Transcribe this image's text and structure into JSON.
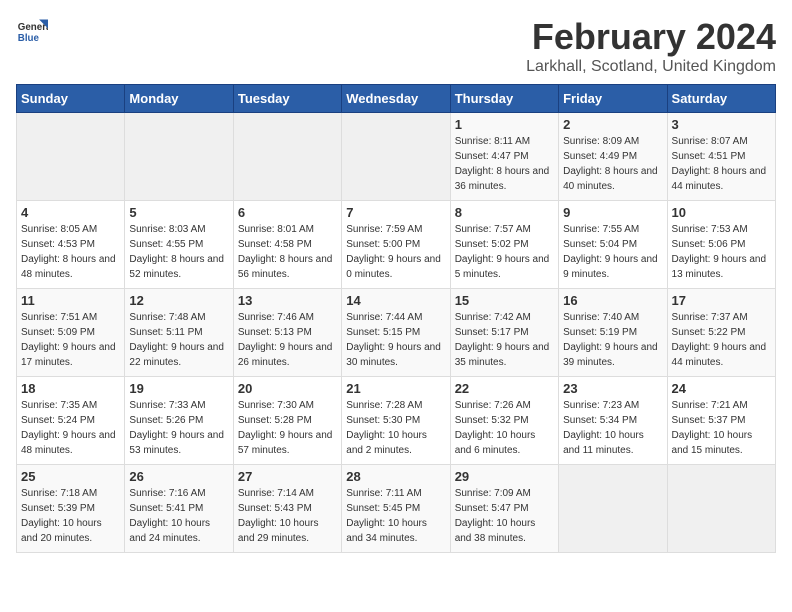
{
  "header": {
    "logo_line1": "General",
    "logo_line2": "Blue",
    "title": "February 2024",
    "subtitle": "Larkhall, Scotland, United Kingdom"
  },
  "weekdays": [
    "Sunday",
    "Monday",
    "Tuesday",
    "Wednesday",
    "Thursday",
    "Friday",
    "Saturday"
  ],
  "weeks": [
    [
      {
        "day": "",
        "sunrise": "",
        "sunset": "",
        "daylight": ""
      },
      {
        "day": "",
        "sunrise": "",
        "sunset": "",
        "daylight": ""
      },
      {
        "day": "",
        "sunrise": "",
        "sunset": "",
        "daylight": ""
      },
      {
        "day": "",
        "sunrise": "",
        "sunset": "",
        "daylight": ""
      },
      {
        "day": "1",
        "sunrise": "Sunrise: 8:11 AM",
        "sunset": "Sunset: 4:47 PM",
        "daylight": "Daylight: 8 hours and 36 minutes."
      },
      {
        "day": "2",
        "sunrise": "Sunrise: 8:09 AM",
        "sunset": "Sunset: 4:49 PM",
        "daylight": "Daylight: 8 hours and 40 minutes."
      },
      {
        "day": "3",
        "sunrise": "Sunrise: 8:07 AM",
        "sunset": "Sunset: 4:51 PM",
        "daylight": "Daylight: 8 hours and 44 minutes."
      }
    ],
    [
      {
        "day": "4",
        "sunrise": "Sunrise: 8:05 AM",
        "sunset": "Sunset: 4:53 PM",
        "daylight": "Daylight: 8 hours and 48 minutes."
      },
      {
        "day": "5",
        "sunrise": "Sunrise: 8:03 AM",
        "sunset": "Sunset: 4:55 PM",
        "daylight": "Daylight: 8 hours and 52 minutes."
      },
      {
        "day": "6",
        "sunrise": "Sunrise: 8:01 AM",
        "sunset": "Sunset: 4:58 PM",
        "daylight": "Daylight: 8 hours and 56 minutes."
      },
      {
        "day": "7",
        "sunrise": "Sunrise: 7:59 AM",
        "sunset": "Sunset: 5:00 PM",
        "daylight": "Daylight: 9 hours and 0 minutes."
      },
      {
        "day": "8",
        "sunrise": "Sunrise: 7:57 AM",
        "sunset": "Sunset: 5:02 PM",
        "daylight": "Daylight: 9 hours and 5 minutes."
      },
      {
        "day": "9",
        "sunrise": "Sunrise: 7:55 AM",
        "sunset": "Sunset: 5:04 PM",
        "daylight": "Daylight: 9 hours and 9 minutes."
      },
      {
        "day": "10",
        "sunrise": "Sunrise: 7:53 AM",
        "sunset": "Sunset: 5:06 PM",
        "daylight": "Daylight: 9 hours and 13 minutes."
      }
    ],
    [
      {
        "day": "11",
        "sunrise": "Sunrise: 7:51 AM",
        "sunset": "Sunset: 5:09 PM",
        "daylight": "Daylight: 9 hours and 17 minutes."
      },
      {
        "day": "12",
        "sunrise": "Sunrise: 7:48 AM",
        "sunset": "Sunset: 5:11 PM",
        "daylight": "Daylight: 9 hours and 22 minutes."
      },
      {
        "day": "13",
        "sunrise": "Sunrise: 7:46 AM",
        "sunset": "Sunset: 5:13 PM",
        "daylight": "Daylight: 9 hours and 26 minutes."
      },
      {
        "day": "14",
        "sunrise": "Sunrise: 7:44 AM",
        "sunset": "Sunset: 5:15 PM",
        "daylight": "Daylight: 9 hours and 30 minutes."
      },
      {
        "day": "15",
        "sunrise": "Sunrise: 7:42 AM",
        "sunset": "Sunset: 5:17 PM",
        "daylight": "Daylight: 9 hours and 35 minutes."
      },
      {
        "day": "16",
        "sunrise": "Sunrise: 7:40 AM",
        "sunset": "Sunset: 5:19 PM",
        "daylight": "Daylight: 9 hours and 39 minutes."
      },
      {
        "day": "17",
        "sunrise": "Sunrise: 7:37 AM",
        "sunset": "Sunset: 5:22 PM",
        "daylight": "Daylight: 9 hours and 44 minutes."
      }
    ],
    [
      {
        "day": "18",
        "sunrise": "Sunrise: 7:35 AM",
        "sunset": "Sunset: 5:24 PM",
        "daylight": "Daylight: 9 hours and 48 minutes."
      },
      {
        "day": "19",
        "sunrise": "Sunrise: 7:33 AM",
        "sunset": "Sunset: 5:26 PM",
        "daylight": "Daylight: 9 hours and 53 minutes."
      },
      {
        "day": "20",
        "sunrise": "Sunrise: 7:30 AM",
        "sunset": "Sunset: 5:28 PM",
        "daylight": "Daylight: 9 hours and 57 minutes."
      },
      {
        "day": "21",
        "sunrise": "Sunrise: 7:28 AM",
        "sunset": "Sunset: 5:30 PM",
        "daylight": "Daylight: 10 hours and 2 minutes."
      },
      {
        "day": "22",
        "sunrise": "Sunrise: 7:26 AM",
        "sunset": "Sunset: 5:32 PM",
        "daylight": "Daylight: 10 hours and 6 minutes."
      },
      {
        "day": "23",
        "sunrise": "Sunrise: 7:23 AM",
        "sunset": "Sunset: 5:34 PM",
        "daylight": "Daylight: 10 hours and 11 minutes."
      },
      {
        "day": "24",
        "sunrise": "Sunrise: 7:21 AM",
        "sunset": "Sunset: 5:37 PM",
        "daylight": "Daylight: 10 hours and 15 minutes."
      }
    ],
    [
      {
        "day": "25",
        "sunrise": "Sunrise: 7:18 AM",
        "sunset": "Sunset: 5:39 PM",
        "daylight": "Daylight: 10 hours and 20 minutes."
      },
      {
        "day": "26",
        "sunrise": "Sunrise: 7:16 AM",
        "sunset": "Sunset: 5:41 PM",
        "daylight": "Daylight: 10 hours and 24 minutes."
      },
      {
        "day": "27",
        "sunrise": "Sunrise: 7:14 AM",
        "sunset": "Sunset: 5:43 PM",
        "daylight": "Daylight: 10 hours and 29 minutes."
      },
      {
        "day": "28",
        "sunrise": "Sunrise: 7:11 AM",
        "sunset": "Sunset: 5:45 PM",
        "daylight": "Daylight: 10 hours and 34 minutes."
      },
      {
        "day": "29",
        "sunrise": "Sunrise: 7:09 AM",
        "sunset": "Sunset: 5:47 PM",
        "daylight": "Daylight: 10 hours and 38 minutes."
      },
      {
        "day": "",
        "sunrise": "",
        "sunset": "",
        "daylight": ""
      },
      {
        "day": "",
        "sunrise": "",
        "sunset": "",
        "daylight": ""
      }
    ]
  ]
}
